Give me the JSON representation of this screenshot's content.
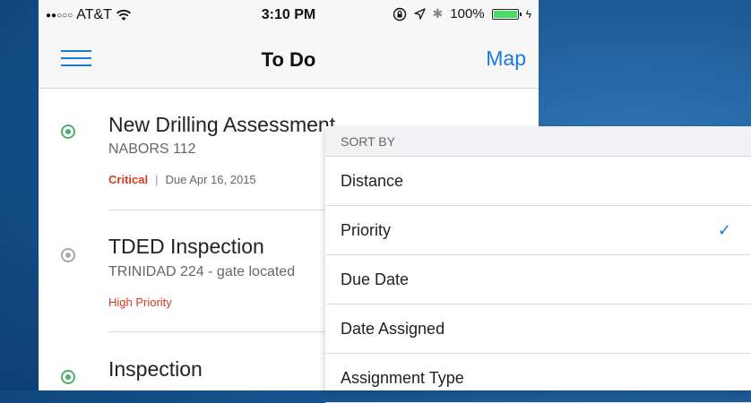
{
  "status_bar": {
    "carrier": "AT&T",
    "time": "3:10 PM",
    "battery": "100%"
  },
  "nav": {
    "title": "To Do",
    "map_label": "Map"
  },
  "tasks": [
    {
      "title": "New Drilling Assessment",
      "subtitle": "NABORS 112",
      "priority": "Critical",
      "separator": "|",
      "due": "Due Apr 16, 2015"
    },
    {
      "title": "TDED Inspection",
      "subtitle": "TRINIDAD 224 - gate located",
      "priority": "High Priority"
    },
    {
      "title": "Inspection"
    }
  ],
  "sort_menu": {
    "header": "SORT BY",
    "options": [
      {
        "label": "Distance",
        "selected": false
      },
      {
        "label": "Priority",
        "selected": true
      },
      {
        "label": "Due Date",
        "selected": false
      },
      {
        "label": "Date Assigned",
        "selected": false
      },
      {
        "label": "Assignment Type",
        "selected": false
      }
    ],
    "check_glyph": "✓"
  },
  "colors": {
    "accent": "#1a7bd6",
    "critical": "#d63b1f",
    "status_green": "#4caf6a",
    "battery_green": "#4cd964"
  }
}
